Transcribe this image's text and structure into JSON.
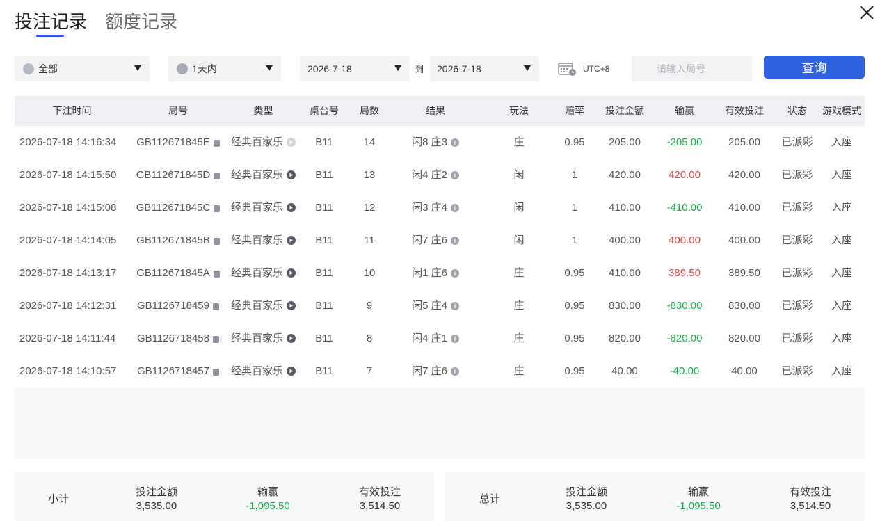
{
  "tabs": [
    {
      "label": "投注记录",
      "active": true
    },
    {
      "label": "额度记录",
      "active": false
    }
  ],
  "filters": {
    "game_type": "全部",
    "time_range": "1天内",
    "date_from": "2026-7-18",
    "to_label": "到",
    "date_to": "2026-7-18",
    "timezone": "UTC+8",
    "round_placeholder": "请输入局号",
    "query_label": "查询"
  },
  "table": {
    "headers": [
      "下注时间",
      "局号",
      "类型",
      "桌台号",
      "局数",
      "结果",
      "玩法",
      "赔率",
      "投注金额",
      "输赢",
      "有效投注",
      "状态",
      "游戏模式"
    ],
    "rows": [
      {
        "time": "2026-07-18 14:16:34",
        "round": "GB112671845E",
        "type": "经典百家乐",
        "play_disabled": true,
        "table": "B11",
        "num": "14",
        "result": "闲8 庄3",
        "bet": "庄",
        "odds": "0.95",
        "amount": "205.00",
        "winloss": "-205.00",
        "wl_sign": "neg",
        "valid": "205.00",
        "status": "已派彩",
        "mode": "入座"
      },
      {
        "time": "2026-07-18 14:15:50",
        "round": "GB112671845D",
        "type": "经典百家乐",
        "play_disabled": false,
        "table": "B11",
        "num": "13",
        "result": "闲4 庄2",
        "bet": "闲",
        "odds": "1",
        "amount": "420.00",
        "winloss": "420.00",
        "wl_sign": "pos",
        "valid": "420.00",
        "status": "已派彩",
        "mode": "入座"
      },
      {
        "time": "2026-07-18 14:15:08",
        "round": "GB112671845C",
        "type": "经典百家乐",
        "play_disabled": false,
        "table": "B11",
        "num": "12",
        "result": "闲3 庄4",
        "bet": "闲",
        "odds": "1",
        "amount": "410.00",
        "winloss": "-410.00",
        "wl_sign": "neg",
        "valid": "410.00",
        "status": "已派彩",
        "mode": "入座"
      },
      {
        "time": "2026-07-18 14:14:05",
        "round": "GB112671845B",
        "type": "经典百家乐",
        "play_disabled": false,
        "table": "B11",
        "num": "11",
        "result": "闲7 庄6",
        "bet": "闲",
        "odds": "1",
        "amount": "400.00",
        "winloss": "400.00",
        "wl_sign": "pos",
        "valid": "400.00",
        "status": "已派彩",
        "mode": "入座"
      },
      {
        "time": "2026-07-18 14:13:17",
        "round": "GB112671845A",
        "type": "经典百家乐",
        "play_disabled": false,
        "table": "B11",
        "num": "10",
        "result": "闲1 庄6",
        "bet": "庄",
        "odds": "0.95",
        "amount": "410.00",
        "winloss": "389.50",
        "wl_sign": "pos",
        "valid": "389.50",
        "status": "已派彩",
        "mode": "入座"
      },
      {
        "time": "2026-07-18 14:12:31",
        "round": "GB1126718459",
        "type": "经典百家乐",
        "play_disabled": false,
        "table": "B11",
        "num": "9",
        "result": "闲5 庄4",
        "bet": "庄",
        "odds": "0.95",
        "amount": "830.00",
        "winloss": "-830.00",
        "wl_sign": "neg",
        "valid": "830.00",
        "status": "已派彩",
        "mode": "入座"
      },
      {
        "time": "2026-07-18 14:11:44",
        "round": "GB1126718458",
        "type": "经典百家乐",
        "play_disabled": false,
        "table": "B11",
        "num": "8",
        "result": "闲4 庄1",
        "bet": "庄",
        "odds": "0.95",
        "amount": "820.00",
        "winloss": "-820.00",
        "wl_sign": "neg",
        "valid": "820.00",
        "status": "已派彩",
        "mode": "入座"
      },
      {
        "time": "2026-07-18 14:10:57",
        "round": "GB1126718457",
        "type": "经典百家乐",
        "play_disabled": false,
        "table": "B11",
        "num": "7",
        "result": "闲7 庄6",
        "bet": "庄",
        "odds": "0.95",
        "amount": "40.00",
        "winloss": "-40.00",
        "wl_sign": "neg",
        "valid": "40.00",
        "status": "已派彩",
        "mode": "入座"
      }
    ]
  },
  "subtotal": {
    "label": "小计",
    "amount_label": "投注金额",
    "amount": "3,535.00",
    "winloss_label": "输赢",
    "winloss": "-1,095.50",
    "valid_label": "有效投注",
    "valid": "3,514.50"
  },
  "total": {
    "label": "总计",
    "amount_label": "投注金额",
    "amount": "3,535.00",
    "winloss_label": "输赢",
    "winloss": "-1,095.50",
    "valid_label": "有效投注",
    "valid": "3,514.50"
  },
  "colors": {
    "accent": "#2f62de",
    "positive": "#e84a4a",
    "negative": "#13b34b"
  }
}
